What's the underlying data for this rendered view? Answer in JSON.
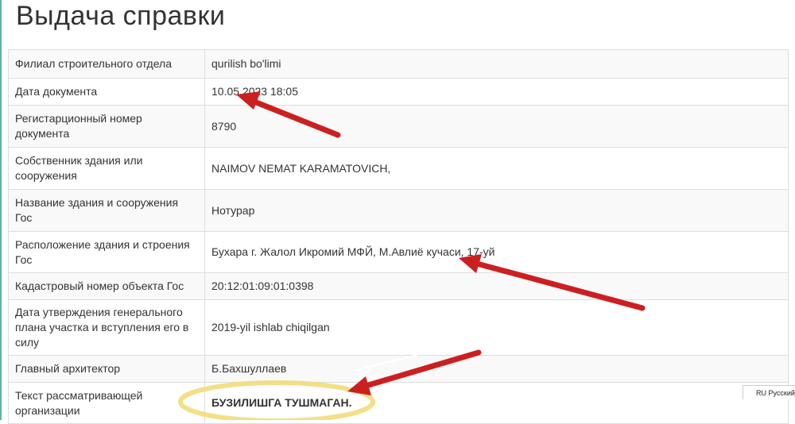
{
  "page": {
    "title": "Выдача справки"
  },
  "rows": [
    {
      "label": "Филиал строительного отдела",
      "value": "qurilish bo'limi"
    },
    {
      "label": "Дата документа",
      "value": "10.05.2023 18:05"
    },
    {
      "label": "Регистарционный номер документа",
      "value": "8790"
    },
    {
      "label": "Собственник здания или сооружения",
      "value": "NAIMOV NEMAT KARAMATOVICH,"
    },
    {
      "label": "Название здания и сооружения Гос",
      "value": "Нотурар"
    },
    {
      "label": "Расположение здания и строения Гос",
      "value": "Бухара г. Жалол Икромий МФЙ, М.Авлиё кучаси, 17-уй"
    },
    {
      "label": "Кадастровый номер объекта Гос",
      "value": "20:12:01:09:01:0398"
    },
    {
      "label": "Дата утверждения генерального плана участка и вступления его в силу",
      "value": "2019-yil ishlab chiqilgan"
    },
    {
      "label": "Главный архитектор",
      "value": "Б.Бахшуллаев"
    },
    {
      "label": "Текст рассматривающей организации",
      "value": "БУЗИЛИШГА ТУШМАГАН."
    }
  ],
  "language_chip": "RU Русский (Россия)",
  "colors": {
    "arrow": "#cc1f1f",
    "highlight": "#f3dc7a",
    "accent_rule": "#5fb1a6",
    "border": "#dddddd"
  }
}
